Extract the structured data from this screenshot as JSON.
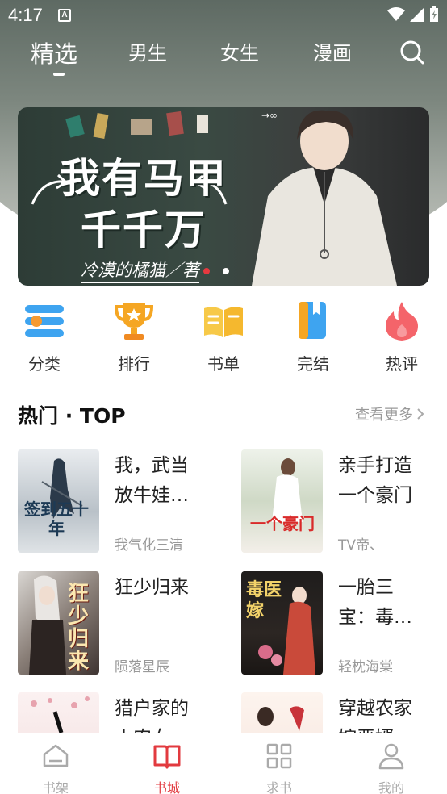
{
  "status_bar": {
    "time": "4:17",
    "notification_letter": "A"
  },
  "top_tabs": [
    {
      "label": "精选",
      "active": true
    },
    {
      "label": "男生",
      "active": false
    },
    {
      "label": "女生",
      "active": false
    },
    {
      "label": "漫画",
      "active": false
    }
  ],
  "banner": {
    "title_line1": "我有马甲",
    "title_line2": "千千万",
    "author": "冷漠的橘猫／著",
    "slide_count": 2,
    "active_slide": 1
  },
  "categories": [
    {
      "label": "分类",
      "icon": "category-list-icon"
    },
    {
      "label": "排行",
      "icon": "trophy-icon"
    },
    {
      "label": "书单",
      "icon": "open-book-icon"
    },
    {
      "label": "完结",
      "icon": "bookmark-book-icon"
    },
    {
      "label": "热评",
      "icon": "flame-icon"
    }
  ],
  "section": {
    "title": "热门 · TOP",
    "more_label": "查看更多"
  },
  "books": [
    {
      "title": "我，武当放牛娃…",
      "author": "我气化三清",
      "cover_text": "签到五十年"
    },
    {
      "title": "亲手打造一个豪门",
      "author": "TV帝、",
      "cover_text": "一个豪门"
    },
    {
      "title": "狂少归来",
      "author": "陨落星辰",
      "cover_text": "狂少归来"
    },
    {
      "title": "一胎三宝：毒…",
      "author": "轻枕海棠",
      "cover_text": "毒医嫁"
    },
    {
      "title": "猎户家的小农女",
      "author": "",
      "cover_text": ""
    },
    {
      "title": "穿越农家嫁恶婿",
      "author": "",
      "cover_text": ""
    }
  ],
  "bottom_nav": [
    {
      "label": "书架",
      "active": false
    },
    {
      "label": "书城",
      "active": true
    },
    {
      "label": "求书",
      "active": false
    },
    {
      "label": "我的",
      "active": false
    }
  ],
  "colors": {
    "accent": "#e23a3f",
    "muted": "#999999"
  }
}
